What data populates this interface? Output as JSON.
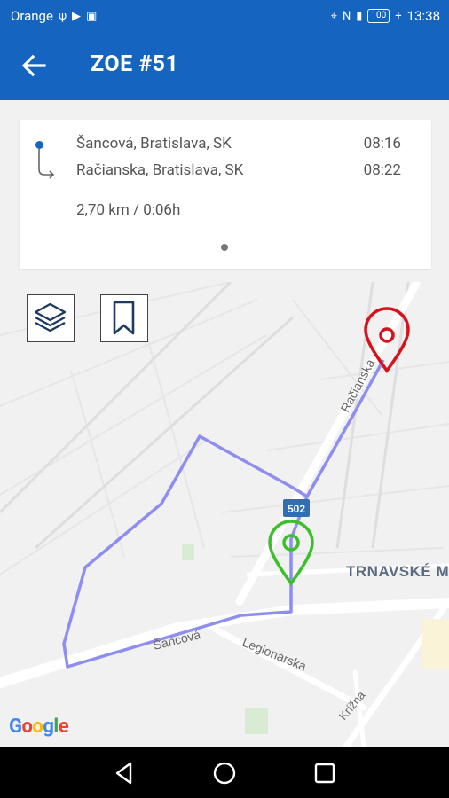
{
  "status_bar": {
    "carrier": "Orange",
    "battery": "100",
    "time": "13:38"
  },
  "app_bar": {
    "title": "ZOE #51",
    "back_icon": "arrow-back-icon"
  },
  "trip": {
    "from": "Šancová, Bratislava, SK",
    "from_time": "08:16",
    "to": "Račianska, Bratislava, SK",
    "to_time": "08:22",
    "summary": "2,70 km /  0:06h"
  },
  "map": {
    "labels": {
      "racianska": "Račianska",
      "sancova": "Šancová",
      "legionarska": "Legionárska",
      "krizna": "Krížna",
      "trnavske": "TRNAVSKÉ M",
      "road_badge": "502"
    },
    "buttons": {
      "layers": "layers-icon",
      "bookmark": "bookmark-icon"
    },
    "colors": {
      "route": "#8e8ef0",
      "start_marker": "#3cbf2b",
      "end_marker": "#d6121b"
    },
    "attribution": [
      "G",
      "o",
      "o",
      "g",
      "l",
      "e"
    ]
  },
  "nav_bar": {
    "back": "triangle-back-icon",
    "home": "circle-home-icon",
    "recents": "square-recents-icon"
  }
}
